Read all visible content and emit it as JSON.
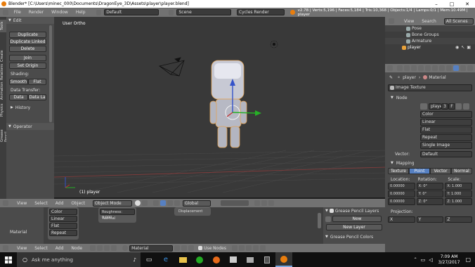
{
  "titlebar": {
    "title": "Blender* [C:\\Users\\minec_000\\Documents\\DragonEye_3D\\Assets\\player\\player.blend]",
    "min": "–",
    "max": "□",
    "close": "✕"
  },
  "info": {
    "menus": [
      "File",
      "Render",
      "Window",
      "Help"
    ],
    "layout": "Default",
    "scene": "Scene",
    "engine": "Cycles Render",
    "stats": "v2.78 | Verts:5,196 | Faces:5,184 | Tris:10,368 | Objects:1/4 | Lamps:0/1 | Mem:10.49M | player"
  },
  "toolshelf": {
    "tabs": [
      "Tools",
      "Create",
      "Relations",
      "Animation",
      "Physics",
      "Grease Pencil"
    ],
    "edit_label": "Edit",
    "duplicate": "Duplicate",
    "duplicate_linked": "Duplicate Linked",
    "delete": "Delete",
    "join": "Join",
    "set_origin": "Set Origin",
    "shading_label": "Shading:",
    "smooth": "Smooth",
    "flat": "Flat",
    "data_transfer_label": "Data Transfer:",
    "data": "Data",
    "data_la": "Data La",
    "history": "History",
    "operator": "Operator"
  },
  "viewport": {
    "view_name": "User Ortho",
    "object_label": "(1) player",
    "header_menus": [
      "View",
      "Select",
      "Add",
      "Object"
    ],
    "mode": "Object Mode",
    "orientation": "Global"
  },
  "outliner": {
    "menus": [
      "View",
      "Search"
    ],
    "scenes": "All Scenes",
    "items": [
      "Pose",
      "Bone Groups",
      "Armature",
      "player"
    ]
  },
  "properties": {
    "breadcrumb": [
      "player",
      "Material"
    ],
    "texture_type": "Image Texture",
    "node_label": "Node",
    "node_name": "playe",
    "node_count": "3",
    "node_f": "F",
    "dropdowns": [
      "Color",
      "Linear",
      "Flat",
      "Repeat",
      "Single Image"
    ],
    "vector_label": "Vector:",
    "vector_value": "Default",
    "mapping_label": "Mapping",
    "mapping_tabs": [
      "Texture",
      "Point",
      "Vector",
      "Normal"
    ],
    "location_label": "Location:",
    "rotation_label": "Rotation:",
    "scale_label": "Scale:",
    "location": [
      "0.00000",
      "0.00000",
      "0.00000"
    ],
    "rotation": [
      "X:    0°",
      "Y:    0°",
      "Z:    0°"
    ],
    "scale": [
      "X:  1.000",
      "Y:  1.000",
      "Z:  1.000"
    ],
    "projection_label": "Projection:",
    "projection": [
      "X",
      "Y",
      "Z"
    ]
  },
  "node_editor": {
    "material_label": "Material",
    "node_rows": [
      "Color",
      "Linear",
      "Flat",
      "Repeat"
    ],
    "roughness": "Roughness:   0.000",
    "normal": "Normal",
    "displacement": "Displacement",
    "gp_layers": "Grease Pencil Layers",
    "gp_new": "New",
    "gp_new_layer": "New Layer",
    "gp_colors": "Grease Pencil Colors",
    "header_menus": [
      "View",
      "Select",
      "Add",
      "Node"
    ],
    "material_field": "Material",
    "use_nodes": "Use Nodes"
  },
  "taskbar": {
    "search": "Ask me anything",
    "time": "7:09 AM",
    "date": "3/27/2017"
  },
  "colors": {
    "accent": "#5680c2",
    "viewport": "#393939",
    "panel": "#4b4b4b",
    "taskbar": "#101010"
  }
}
